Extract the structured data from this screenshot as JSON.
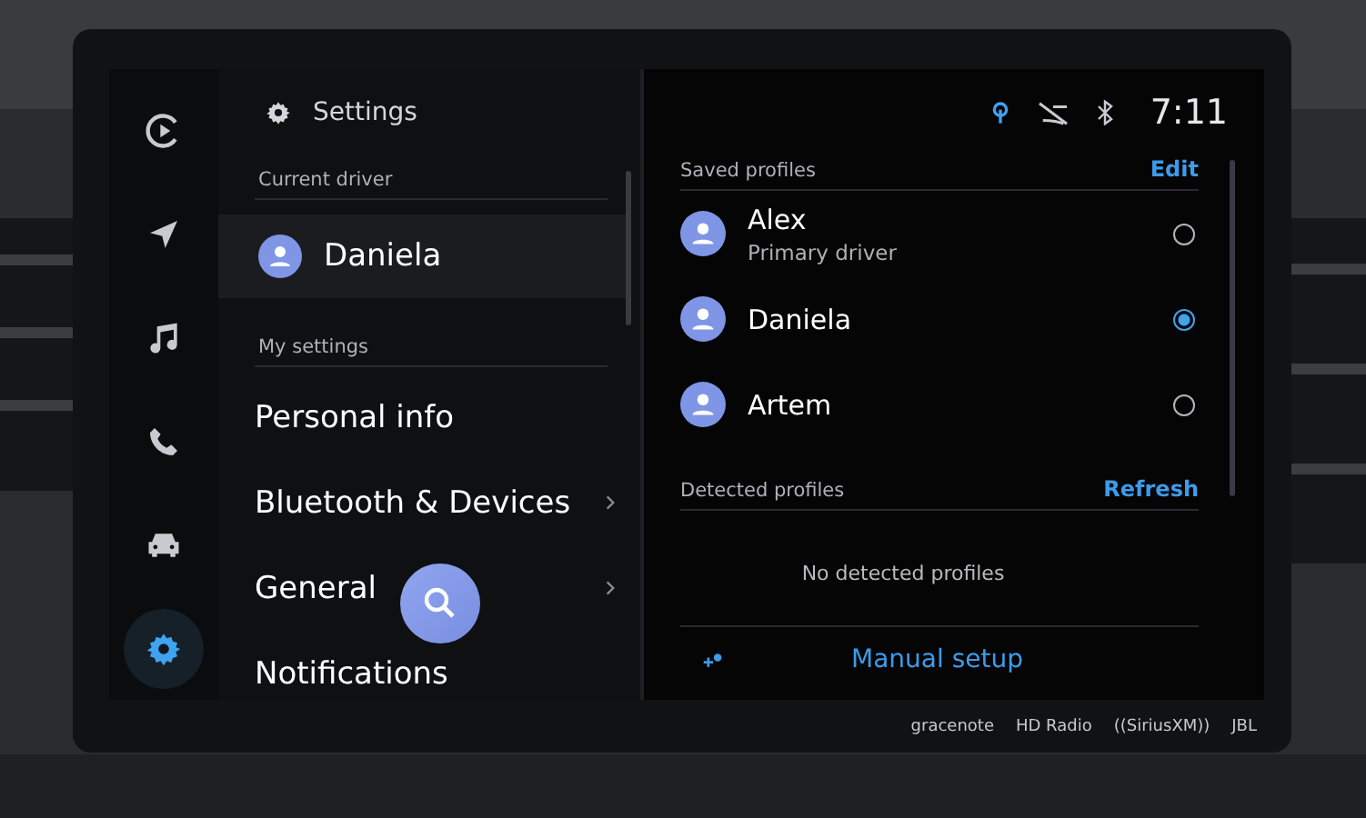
{
  "rail": [
    {
      "kind": "media",
      "selected": false
    },
    {
      "kind": "navigation",
      "selected": false
    },
    {
      "kind": "music",
      "selected": false
    },
    {
      "kind": "phone",
      "selected": false
    },
    {
      "kind": "car",
      "selected": false
    },
    {
      "kind": "settings",
      "selected": true
    }
  ],
  "settings": {
    "title": "Settings",
    "current_driver_label": "Current driver",
    "current_driver": "Daniela",
    "my_settings_label": "My settings",
    "items": [
      {
        "label": "Personal info",
        "has_arrow": false
      },
      {
        "label": "Bluetooth & Devices",
        "has_arrow": true
      },
      {
        "label": "General",
        "has_arrow": true
      },
      {
        "label": "Notifications",
        "has_arrow": false
      }
    ]
  },
  "status_bar": {
    "time": "7:11"
  },
  "saved_profiles": {
    "label": "Saved profiles",
    "action": "Edit",
    "profiles": [
      {
        "name": "Alex",
        "subtitle": "Primary driver",
        "selected": false
      },
      {
        "name": "Daniela",
        "selected": true
      },
      {
        "name": "Artem",
        "selected": false
      }
    ]
  },
  "detected_profiles": {
    "label": "Detected profiles",
    "action": "Refresh",
    "empty_text": "No detected profiles"
  },
  "manual_setup": "Manual setup",
  "logos": [
    "gracenote",
    "HD Radio",
    "((SiriusXM))",
    "JBL"
  ]
}
